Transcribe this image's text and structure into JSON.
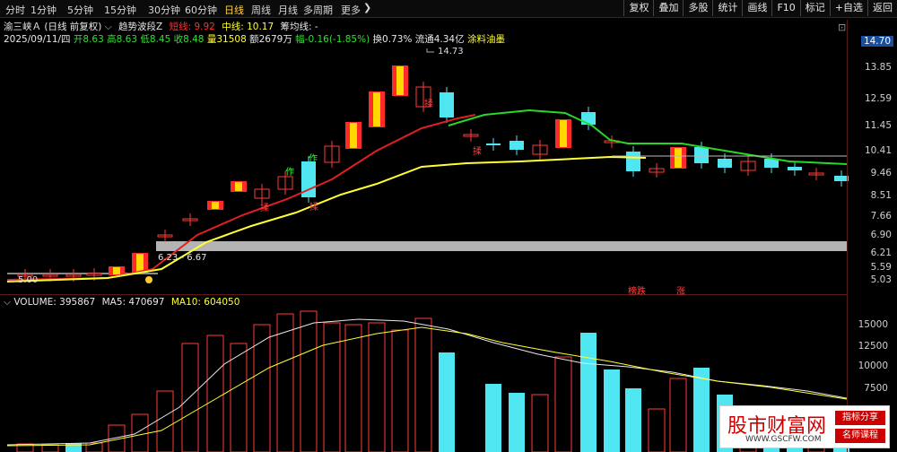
{
  "toolbar": {
    "timeframes": [
      "分时",
      "1分钟",
      "5分钟",
      "15分钟",
      "30分钟",
      "60分钟",
      "日线",
      "周线",
      "月线",
      "多周期",
      "更多"
    ],
    "active": "日线",
    "right_buttons": [
      "复权",
      "叠加",
      "多股",
      "统计",
      "画线",
      "F10",
      "标记",
      "+自选",
      "返回"
    ]
  },
  "info": {
    "stock": "渝三峡Ａ",
    "mode": "(日线 前复权)",
    "indicator": "趋势波段Z",
    "short_label": "短线:",
    "short_val": "9.92",
    "mid_label": "中线:",
    "mid_val": "10.17",
    "chip_label": "筹均线: -"
  },
  "quote": {
    "date": "2025/09/11/四",
    "open": "开8.63",
    "high": "高8.63",
    "low": "低8.45",
    "close": "收8.48",
    "vol": "量31508",
    "amount": "额2679万",
    "change": "幅-0.16(-1.85%)",
    "turnover": "换0.73%",
    "float": "流通4.34亿",
    "sector": "涂料油墨"
  },
  "price_axis": [
    "14.70",
    "13.85",
    "12.59",
    "11.45",
    "10.41",
    "9.46",
    "8.51",
    "7.66",
    "6.90",
    "6.21",
    "5.59",
    "5.03"
  ],
  "annotations": {
    "high_mark": "14.73",
    "low_mark": "5.00",
    "range": "6.23 - 6.67",
    "tag1": "榜跌",
    "tag2": "涨",
    "buy": "作",
    "sell": "揉"
  },
  "volume": {
    "title": "VOLUME: 395867",
    "ma5": "MA5: 470697",
    "ma10": "MA10: 604050",
    "axis": [
      "15000",
      "12500",
      "10000",
      "7500"
    ]
  },
  "watermark": {
    "brand": "股市财富网",
    "url": "WWW.GSCFW.COM",
    "tag1": "指标分享",
    "tag2": "名师课程"
  },
  "colors": {
    "up": "#ff3b3b",
    "down": "#4fe6f2",
    "short": "#e02020",
    "mid": "#ffff33",
    "long": "#27d827"
  }
}
